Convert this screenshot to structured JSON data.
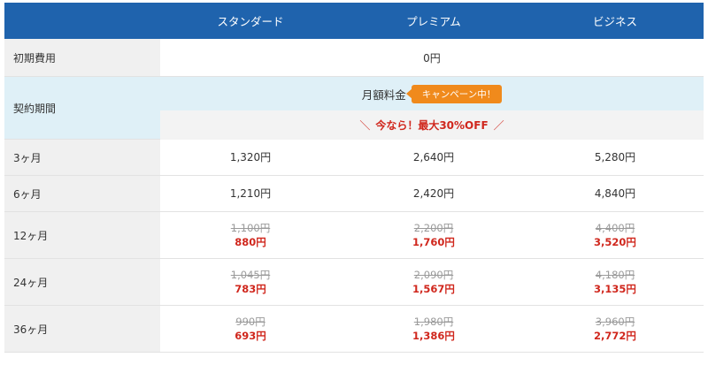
{
  "header": {
    "plans": [
      "スタンダード",
      "プレミアム",
      "ビジネス"
    ]
  },
  "initial_fee": {
    "label": "初期費用",
    "value": "0円"
  },
  "contract": {
    "label": "契約期間",
    "monthly_label": "月額料金",
    "campaign_badge": "キャンペーン中！",
    "promo_left": "＼",
    "promo_text": "今なら！最大30%OFF",
    "promo_right": "／"
  },
  "rows": [
    {
      "label": "3ヶ月",
      "prices": [
        {
          "new": "1,320円"
        },
        {
          "new": "2,640円"
        },
        {
          "new": "5,280円"
        }
      ]
    },
    {
      "label": "6ヶ月",
      "prices": [
        {
          "new": "1,210円"
        },
        {
          "new": "2,420円"
        },
        {
          "new": "4,840円"
        }
      ]
    },
    {
      "label": "12ヶ月",
      "prices": [
        {
          "old": "1,100円",
          "new": "880円"
        },
        {
          "old": "2,200円",
          "new": "1,760円"
        },
        {
          "old": "4,400円",
          "new": "3,520円"
        }
      ]
    },
    {
      "label": "24ヶ月",
      "prices": [
        {
          "old": "1,045円",
          "new": "783円"
        },
        {
          "old": "2,090円",
          "new": "1,567円"
        },
        {
          "old": "4,180円",
          "new": "3,135円"
        }
      ]
    },
    {
      "label": "36ヶ月",
      "prices": [
        {
          "old": "990円",
          "new": "693円"
        },
        {
          "old": "1,980円",
          "new": "1,386円"
        },
        {
          "old": "3,960円",
          "new": "2,772円"
        }
      ]
    }
  ],
  "colors": {
    "header_bg": "#1f63ad",
    "contract_bg": "#dff0f7",
    "badge_bg": "#f08a1c",
    "discount_red": "#d0271d"
  }
}
